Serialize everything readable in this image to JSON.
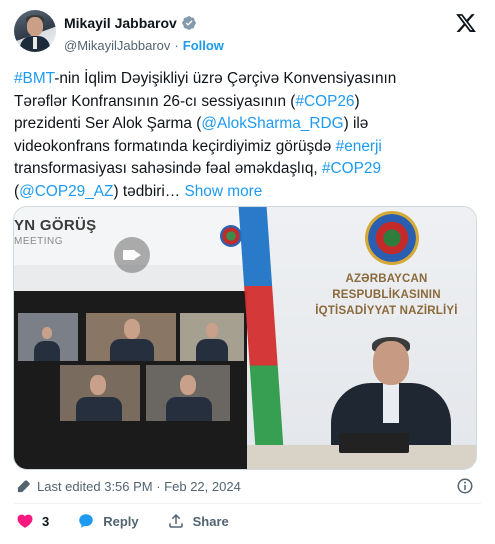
{
  "author": {
    "display_name": "Mikayil Jabbarov",
    "handle": "@MikayilJabbarov",
    "separator": "·",
    "follow_label": "Follow"
  },
  "tweet": {
    "lines": [
      [
        {
          "t": "#BMT",
          "link": true
        },
        {
          "t": "-nin İqlim Dəyişikliyi üzrə Çərçivə Konvensiyasının",
          "link": false
        }
      ],
      [
        {
          "t": "Tərəflər Konfransının 26-cı sessiyasının (",
          "link": false
        },
        {
          "t": "#COP26",
          "link": true
        },
        {
          "t": ")",
          "link": false
        }
      ],
      [
        {
          "t": "prezidenti Ser Alok Şarma (",
          "link": false
        },
        {
          "t": "@AlokSharma_RDG",
          "link": true
        },
        {
          "t": ") ilə",
          "link": false
        }
      ],
      [
        {
          "t": "videokonfrans formatında keçirdiyimiz görüşdə ",
          "link": false
        },
        {
          "t": "#enerji",
          "link": true
        }
      ],
      [
        {
          "t": "transformasiyası sahəsində fəal əməkdaşlıq, ",
          "link": false
        },
        {
          "t": "#COP29",
          "link": true
        }
      ],
      [
        {
          "t": "(",
          "link": false
        },
        {
          "t": "@COP29_AZ",
          "link": true
        },
        {
          "t": ") tədbiri… ",
          "link": false
        }
      ]
    ],
    "show_more": "Show more"
  },
  "media": {
    "left_banner_title": "YN GÖRÜŞ",
    "left_banner_sub": "MEETING",
    "ministry_line1": "AZƏRBAYCAN RESPUBLİKASININ",
    "ministry_line2": "İQTİSADİYYAT NAZİRLİYİ"
  },
  "meta": {
    "edited_label": "Last edited 3:56 PM · Feb 22, 2024"
  },
  "actions": {
    "like_count": "3",
    "reply_label": "Reply",
    "share_label": "Share"
  },
  "colors": {
    "accent": "#1d9bf0",
    "like": "#f91880",
    "muted": "#536471"
  },
  "icons": [
    "verified-badge-icon",
    "x-logo-icon",
    "pencil-icon",
    "info-icon",
    "heart-icon",
    "reply-icon",
    "share-icon",
    "camera-icon"
  ]
}
